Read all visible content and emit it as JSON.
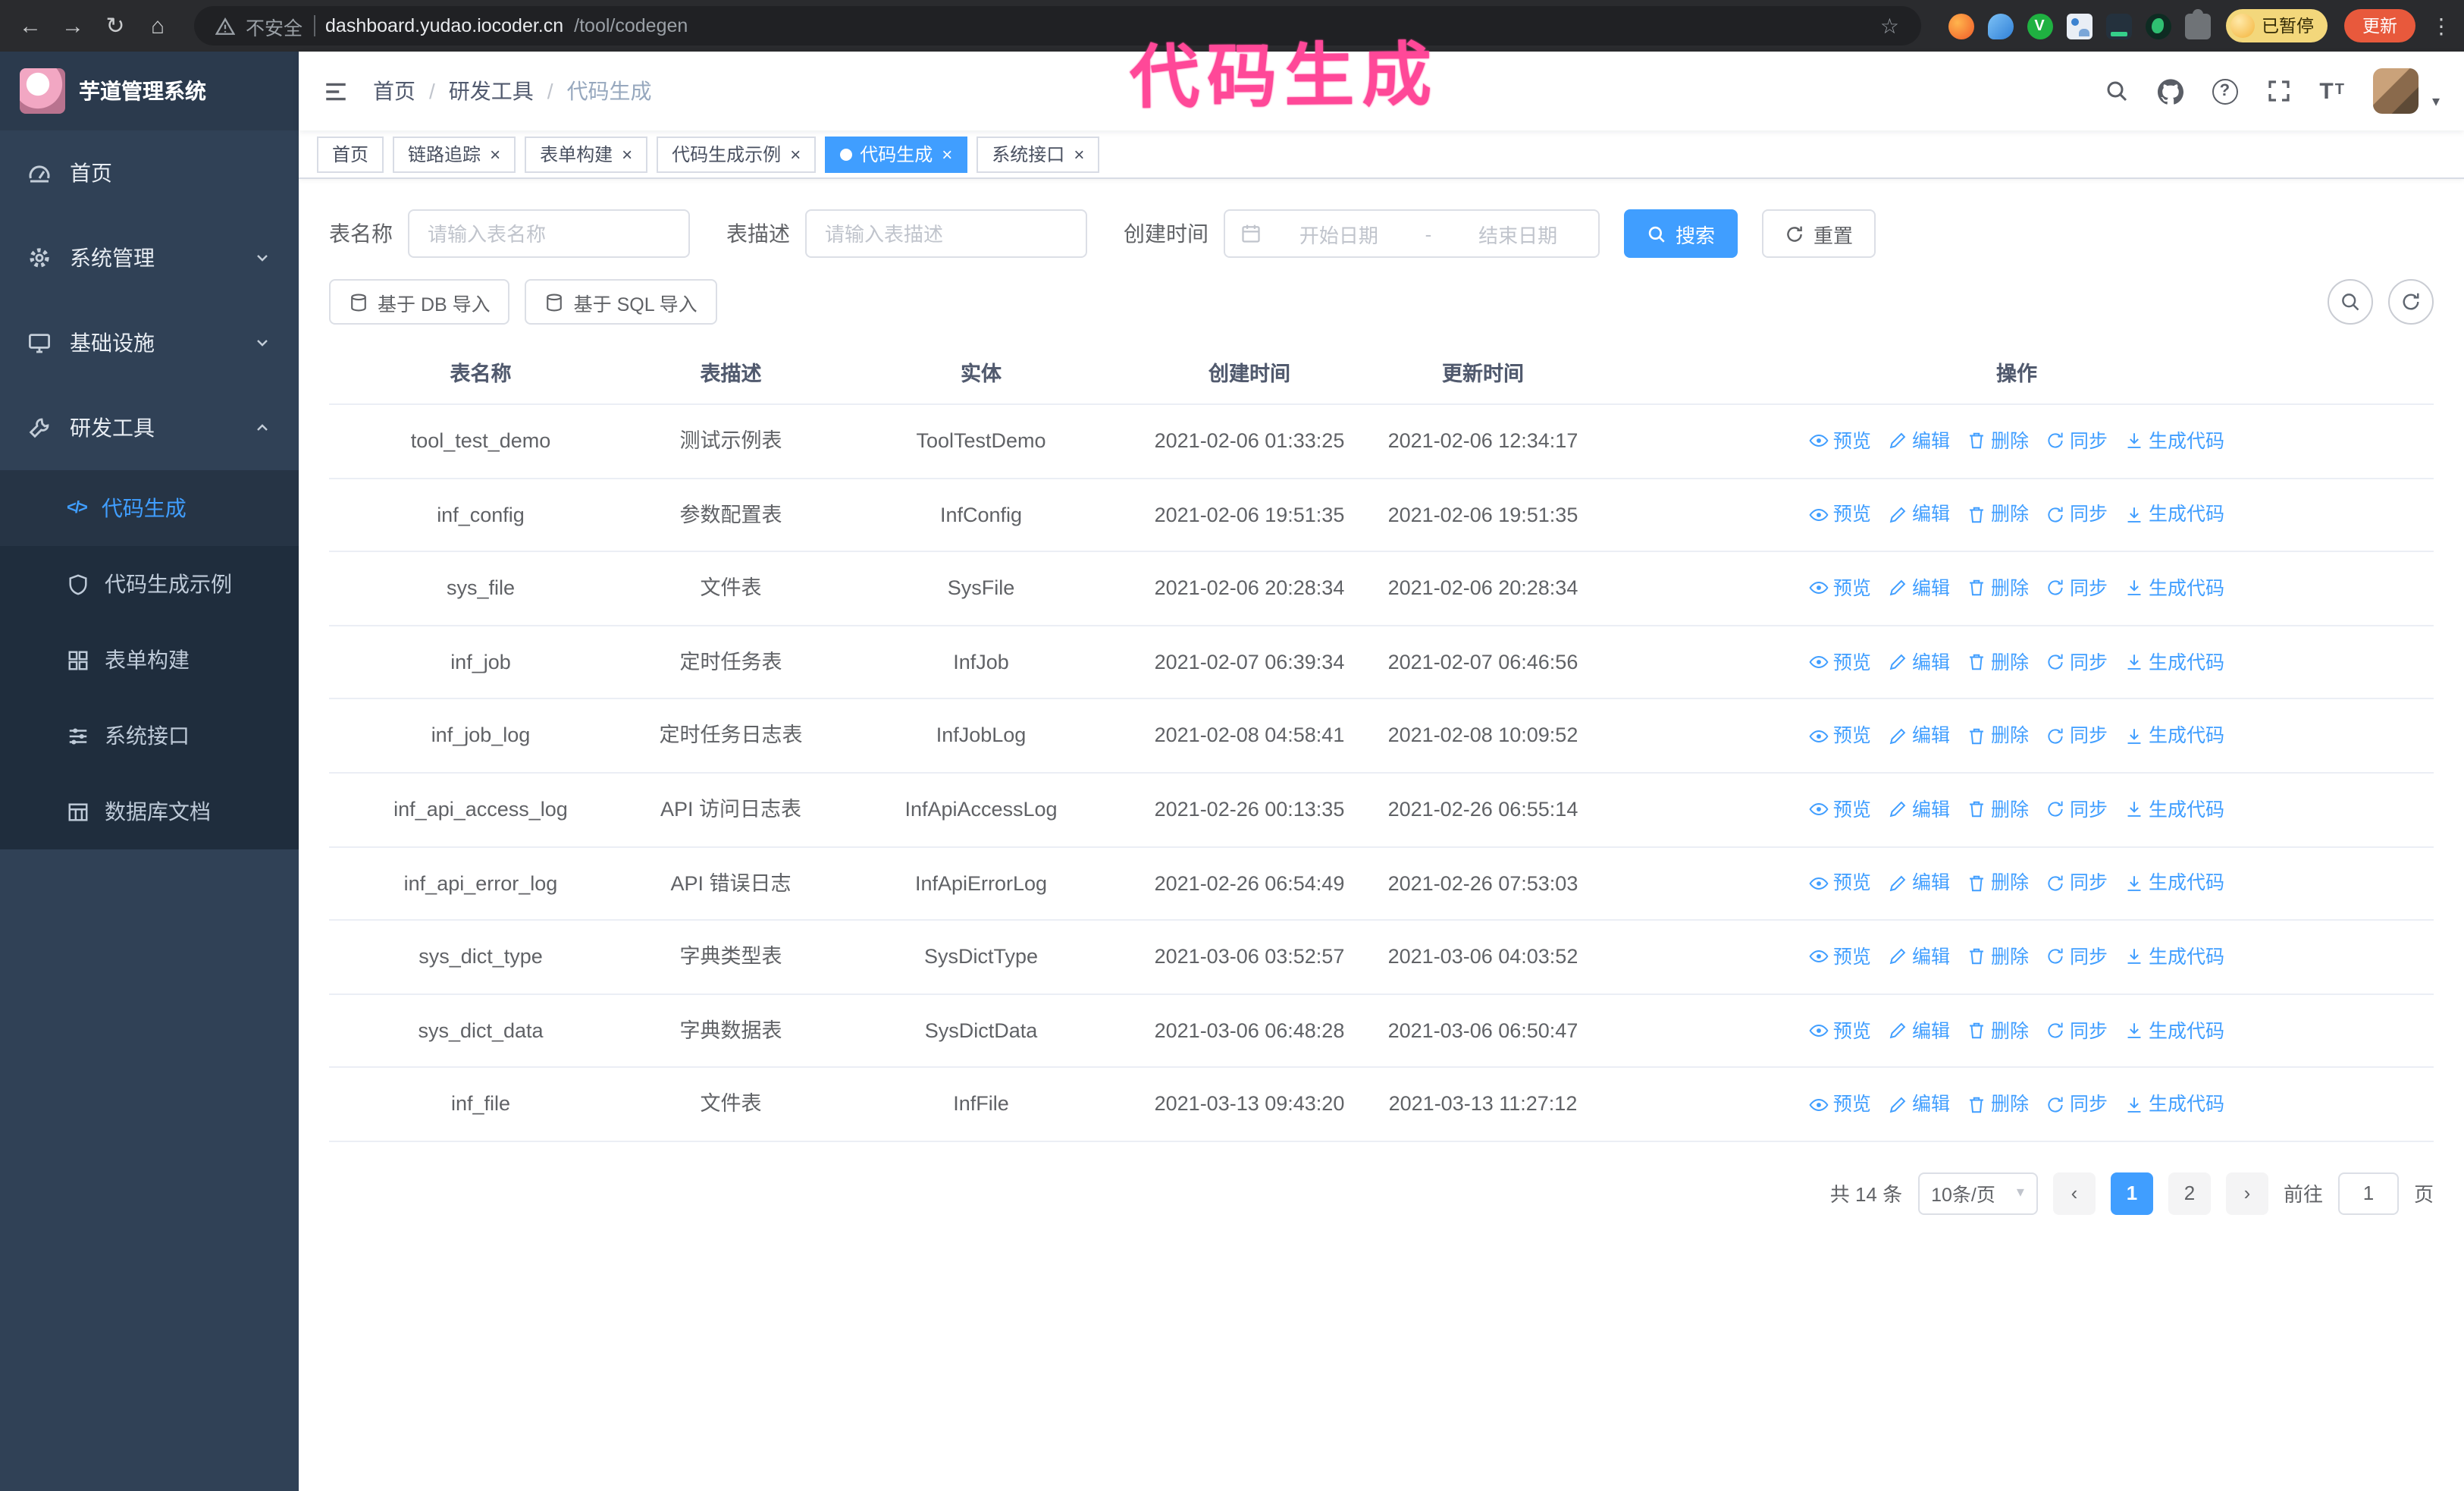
{
  "colors": {
    "primary": "#409eff",
    "sidebar_bg": "#304156",
    "submenu_bg": "#1f2d3d",
    "annotation_pink": "#ff4898",
    "update_button_bg": "#e8593c",
    "paused_chip_bg": "#f3d77b"
  },
  "annotation": {
    "text": "代码生成"
  },
  "icons": {
    "back": "←",
    "forward": "→",
    "reload": "↻",
    "home": "⌂",
    "star": "☆",
    "kebab": "⋮",
    "close": "×",
    "caret": "▾",
    "question": "?",
    "font_t": "T",
    "code": "</>",
    "ext_badge": "V",
    "prev": "‹",
    "next": "›"
  },
  "browser": {
    "security_label": "不安全",
    "url_host": "dashboard.yudao.iocoder.cn",
    "url_path": "/tool/codegen",
    "profile_chip": "已暂停",
    "update_button": "更新"
  },
  "sidebar": {
    "logo_title": "芋道管理系统",
    "items": [
      {
        "label": "首页"
      },
      {
        "label": "系统管理"
      },
      {
        "label": "基础设施"
      },
      {
        "label": "研发工具"
      }
    ],
    "submenu": [
      {
        "label": "代码生成"
      },
      {
        "label": "代码生成示例"
      },
      {
        "label": "表单构建"
      },
      {
        "label": "系统接口"
      },
      {
        "label": "数据库文档"
      }
    ]
  },
  "breadcrumb": {
    "separator": "/",
    "items": [
      "首页",
      "研发工具",
      "代码生成"
    ]
  },
  "tabs": [
    {
      "label": "首页"
    },
    {
      "label": "链路追踪"
    },
    {
      "label": "表单构建"
    },
    {
      "label": "代码生成示例"
    },
    {
      "label": "代码生成"
    },
    {
      "label": "系统接口"
    }
  ],
  "filters": {
    "name_label": "表名称",
    "name_placeholder": "请输入表名称",
    "desc_label": "表描述",
    "desc_placeholder": "请输入表描述",
    "time_label": "创建时间",
    "start_placeholder": "开始日期",
    "range_separator": "-",
    "end_placeholder": "结束日期",
    "search": "搜索",
    "reset": "重置"
  },
  "toolbar": {
    "import_db": "基于 DB 导入",
    "import_sql": "基于 SQL 导入"
  },
  "table": {
    "columns": [
      "表名称",
      "表描述",
      "实体",
      "创建时间",
      "更新时间",
      "操作"
    ],
    "actions": {
      "preview": "预览",
      "edit": "编辑",
      "delete": "删除",
      "sync": "同步",
      "generate": "生成代码"
    },
    "rows": [
      {
        "name": "tool_test_demo",
        "desc": "测试示例表",
        "entity": "ToolTestDemo",
        "created": "2021-02-06 01:33:25",
        "updated": "2021-02-06 12:34:17"
      },
      {
        "name": "inf_config",
        "desc": "参数配置表",
        "entity": "InfConfig",
        "created": "2021-02-06 19:51:35",
        "updated": "2021-02-06 19:51:35"
      },
      {
        "name": "sys_file",
        "desc": "文件表",
        "entity": "SysFile",
        "created": "2021-02-06 20:28:34",
        "updated": "2021-02-06 20:28:34"
      },
      {
        "name": "inf_job",
        "desc": "定时任务表",
        "entity": "InfJob",
        "created": "2021-02-07 06:39:34",
        "updated": "2021-02-07 06:46:56"
      },
      {
        "name": "inf_job_log",
        "desc": "定时任务日志表",
        "entity": "InfJobLog",
        "created": "2021-02-08 04:58:41",
        "updated": "2021-02-08 10:09:52"
      },
      {
        "name": "inf_api_access_log",
        "desc": "API 访问日志表",
        "entity": "InfApiAccessLog",
        "created": "2021-02-26 00:13:35",
        "updated": "2021-02-26 06:55:14"
      },
      {
        "name": "inf_api_error_log",
        "desc": "API 错误日志",
        "entity": "InfApiErrorLog",
        "created": "2021-02-26 06:54:49",
        "updated": "2021-02-26 07:53:03"
      },
      {
        "name": "sys_dict_type",
        "desc": "字典类型表",
        "entity": "SysDictType",
        "created": "2021-03-06 03:52:57",
        "updated": "2021-03-06 04:03:52"
      },
      {
        "name": "sys_dict_data",
        "desc": "字典数据表",
        "entity": "SysDictData",
        "created": "2021-03-06 06:48:28",
        "updated": "2021-03-06 06:50:47"
      },
      {
        "name": "inf_file",
        "desc": "文件表",
        "entity": "InfFile",
        "created": "2021-03-13 09:43:20",
        "updated": "2021-03-13 11:27:12"
      }
    ]
  },
  "pagination": {
    "total": "共 14 条",
    "page_size": "10条/页",
    "pages": [
      "1",
      "2"
    ],
    "goto_label": "前往",
    "goto_value": "1",
    "goto_unit": "页"
  }
}
